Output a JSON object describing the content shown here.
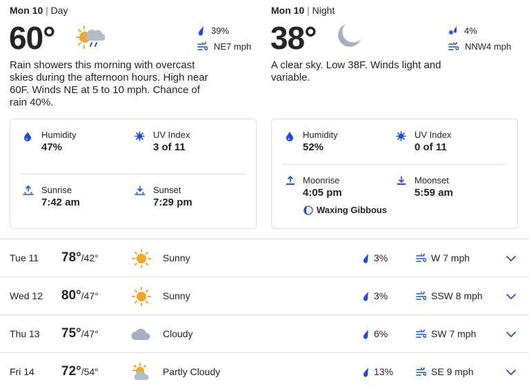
{
  "colors": {
    "accent": "#1b4de4",
    "sun": "#f5a623",
    "moon": "#a7b0c2",
    "border": "#dedede"
  },
  "day": {
    "label_day": "Mon 10",
    "label_sep": "|",
    "label_part": "Day",
    "temp": "60°",
    "precip": "39%",
    "wind": "NE7 mph",
    "narrative": "Rain showers this morning with overcast skies during the afternoon hours. High near 60F. Winds NE at 5 to 10 mph. Chance of rain 40%.",
    "details": {
      "humidity_label": "Humidity",
      "humidity_value": "47%",
      "uv_label": "UV Index",
      "uv_value": "3 of 11",
      "sunrise_label": "Sunrise",
      "sunrise_value": "7:42 am",
      "sunset_label": "Sunset",
      "sunset_value": "7:29 pm"
    }
  },
  "night": {
    "label_day": "Mon 10",
    "label_sep": "|",
    "label_part": "Night",
    "temp": "38°",
    "precip": "4%",
    "wind": "NNW4 mph",
    "narrative": "A clear sky. Low 38F. Winds light and variable.",
    "details": {
      "humidity_label": "Humidity",
      "humidity_value": "52%",
      "uv_label": "UV Index",
      "uv_value": "0 of 11",
      "moonrise_label": "Moonrise",
      "moonrise_value": "4:05 pm",
      "moonset_label": "Moonset",
      "moonset_value": "5:59 am",
      "moon_phase": "Waxing Gibbous"
    }
  },
  "forecast": [
    {
      "date": "Tue 11",
      "hi": "78°",
      "lo": "/42°",
      "icon": "sun-icon",
      "condition": "Sunny",
      "precip": "3%",
      "wind": "W 7 mph"
    },
    {
      "date": "Wed 12",
      "hi": "80°",
      "lo": "/47°",
      "icon": "sun-icon",
      "condition": "Sunny",
      "precip": "3%",
      "wind": "SSW 8 mph"
    },
    {
      "date": "Thu 13",
      "hi": "75°",
      "lo": "/47°",
      "icon": "cloud-icon",
      "condition": "Cloudy",
      "precip": "6%",
      "wind": "SW 7 mph"
    },
    {
      "date": "Fri 14",
      "hi": "72°",
      "lo": "/54°",
      "icon": "partly-cloudy-icon",
      "condition": "Partly Cloudy",
      "precip": "13%",
      "wind": "SE 9 mph"
    }
  ]
}
